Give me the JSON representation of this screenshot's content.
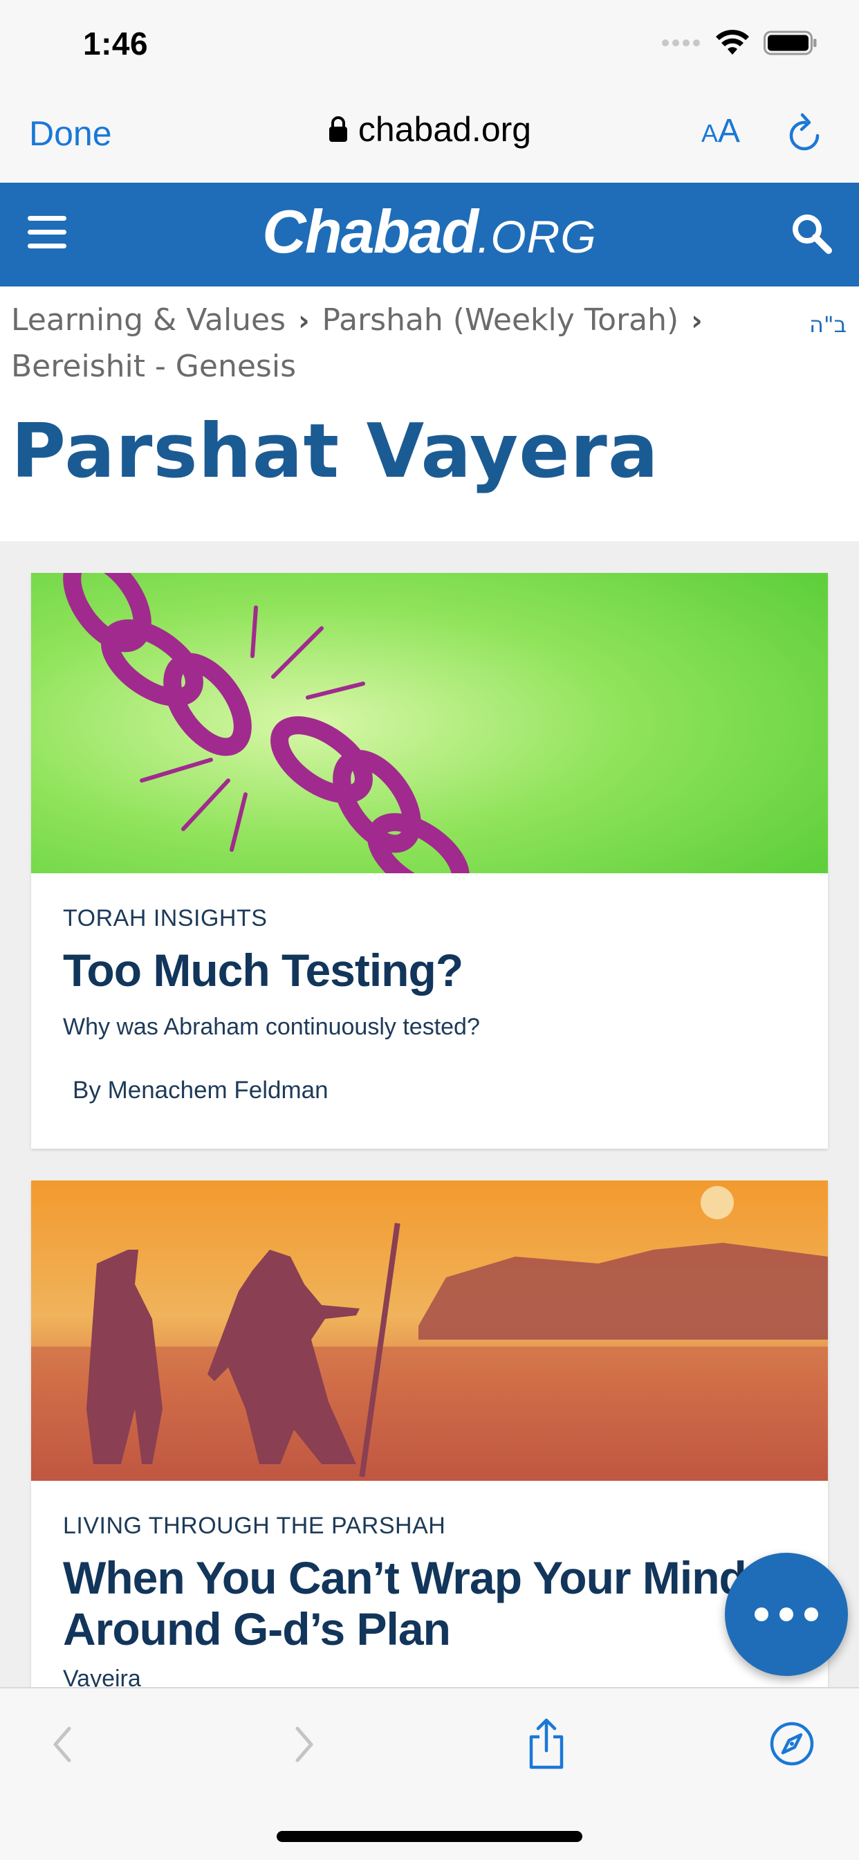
{
  "status_bar": {
    "time": "1:46"
  },
  "browser": {
    "done_label": "Done",
    "url": "chabad.org",
    "text_size_label_small": "A",
    "text_size_label_large": "A"
  },
  "site": {
    "logo_main": "Chabad",
    "logo_sub": ".ORG"
  },
  "breadcrumb": {
    "items": [
      "Learning & Values",
      "Parshah (Weekly Torah)",
      "Bereishit - Genesis"
    ],
    "bh": "ב\"ה"
  },
  "page_title": "Parshat Vayera",
  "cards": [
    {
      "category": "TORAH INSIGHTS",
      "title": "Too Much Testing?",
      "description": "Why was Abraham continuously tested?",
      "author": "By Menachem Feldman"
    },
    {
      "category": "LIVING THROUGH THE PARSHAH",
      "title_line1": "When You Can’t Wrap Your Mind",
      "title_line2": "Around G-d’s Plan",
      "subtitle": "Vayeira"
    }
  ],
  "colors": {
    "accent": "#1a78d6",
    "brand": "#1f6db8",
    "title": "#1b5b94",
    "card_title": "#12355b"
  }
}
